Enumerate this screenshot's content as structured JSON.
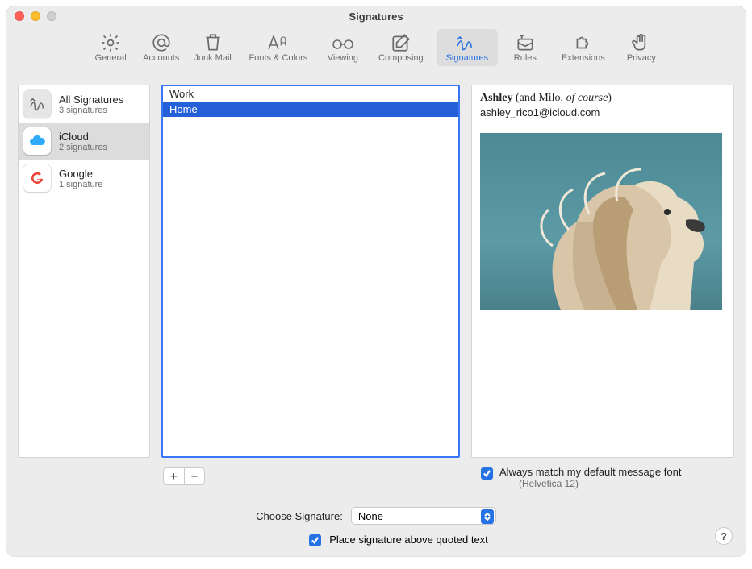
{
  "window": {
    "title": "Signatures"
  },
  "toolbar": {
    "items": [
      {
        "id": "general",
        "label": "General"
      },
      {
        "id": "accounts",
        "label": "Accounts"
      },
      {
        "id": "junk",
        "label": "Junk Mail"
      },
      {
        "id": "fonts",
        "label": "Fonts & Colors"
      },
      {
        "id": "viewing",
        "label": "Viewing"
      },
      {
        "id": "composing",
        "label": "Composing"
      },
      {
        "id": "signatures",
        "label": "Signatures",
        "selected": true
      },
      {
        "id": "rules",
        "label": "Rules"
      },
      {
        "id": "extensions",
        "label": "Extensions"
      },
      {
        "id": "privacy",
        "label": "Privacy"
      }
    ]
  },
  "accounts": [
    {
      "id": "all",
      "title": "All Signatures",
      "sub": "3 signatures"
    },
    {
      "id": "icloud",
      "title": "iCloud",
      "sub": "2 signatures",
      "selected": true
    },
    {
      "id": "google",
      "title": "Google",
      "sub": "1 signature"
    }
  ],
  "signatures": [
    {
      "id": "work",
      "name": "Work"
    },
    {
      "id": "home",
      "name": "Home",
      "selected": true
    }
  ],
  "preview": {
    "name_bold": "Ashley",
    "name_rest": " (and Milo, ",
    "name_italic": "of course",
    "name_tail": ")",
    "email": "ashley_rico1@icloud.com"
  },
  "options": {
    "match_font_label": "Always match my default message font",
    "match_font_sub": "(Helvetica 12)",
    "match_font_checked": true,
    "choose_signature_label": "Choose Signature:",
    "choose_signature_value": "None",
    "place_above_label": "Place signature above quoted text",
    "place_above_checked": true
  },
  "buttons": {
    "add": "+",
    "remove": "−",
    "help": "?"
  }
}
